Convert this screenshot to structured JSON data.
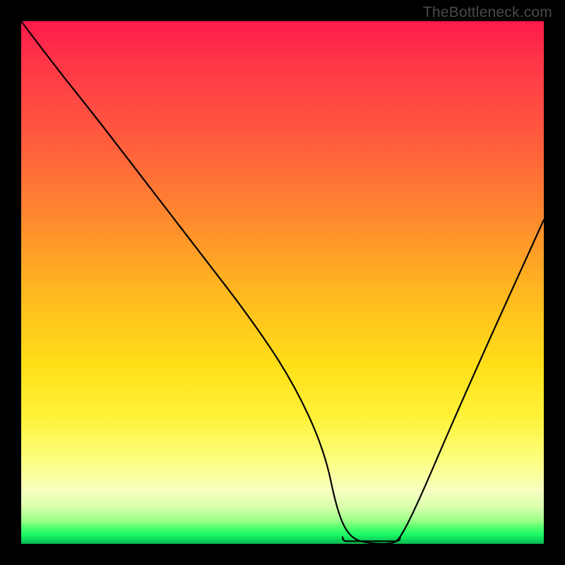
{
  "watermark": "TheBottleneck.com",
  "colors": {
    "frame": "#000000",
    "gradient_top": "#ff1a4a",
    "gradient_mid": "#ffe018",
    "gradient_bottom": "#0bb74f",
    "curve": "#000000",
    "marker": "#e2766e"
  },
  "chart_data": {
    "type": "line",
    "title": "",
    "xlabel": "",
    "ylabel": "",
    "xlim": [
      0,
      100
    ],
    "ylim": [
      0,
      100
    ],
    "series": [
      {
        "name": "bottleneck-curve",
        "x": [
          0,
          6,
          14,
          24,
          34,
          44,
          52,
          58,
          60.5,
          63,
          67,
          71,
          72.5,
          76,
          82,
          90,
          100
        ],
        "y": [
          100,
          92,
          82,
          69,
          56,
          43,
          31,
          18,
          6,
          1,
          0,
          0,
          1,
          8,
          22,
          40,
          62
        ]
      }
    ],
    "annotations": [
      {
        "name": "optimal-flat-region",
        "x_start": 61.5,
        "x_end": 72.5,
        "y": 0.5
      }
    ]
  }
}
